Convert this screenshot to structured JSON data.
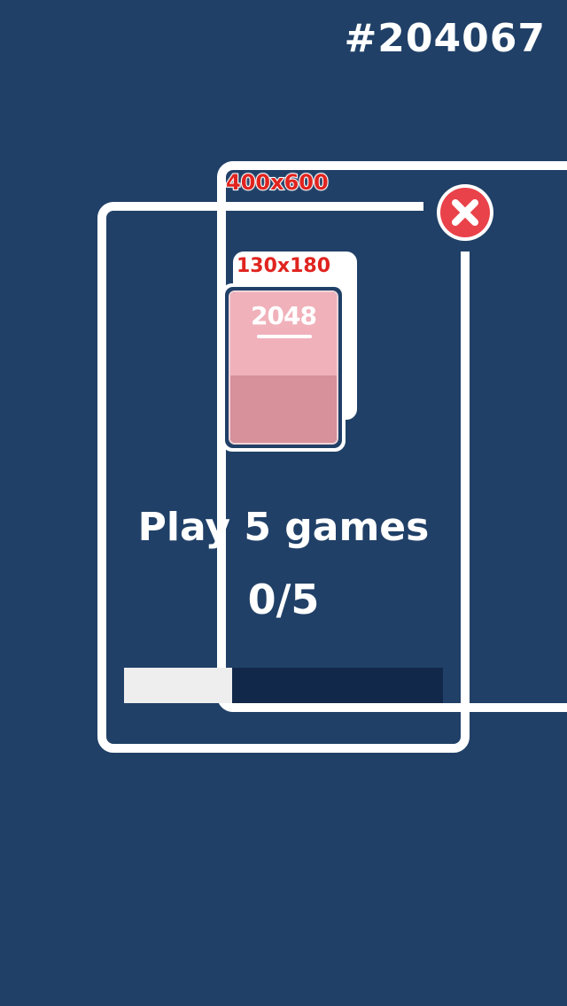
{
  "header": {
    "hex_code": "#204067"
  },
  "labels": {
    "panel_size": "400x600",
    "card_size": "130x180"
  },
  "card": {
    "title": "2048"
  },
  "goal": {
    "text": "Play 5 games",
    "progress_text": "0/5",
    "bar_fill_fraction": 0.34
  },
  "colors": {
    "background": "#204067",
    "bar_track": "#12284a",
    "bar_fill": "#eeeeef",
    "close_red": "#e9424a",
    "label_red": "#e0241f",
    "card_top": "#f0b1ba",
    "card_bottom": "#d6919a"
  },
  "icons": {
    "close": "close-icon"
  }
}
